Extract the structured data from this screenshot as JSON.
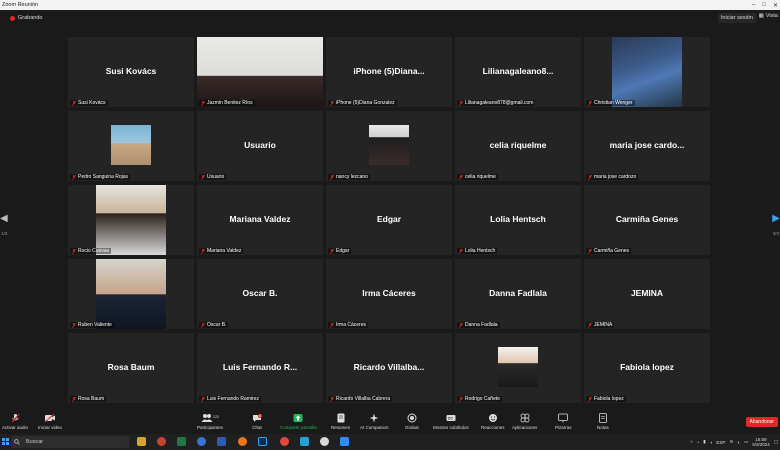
{
  "window": {
    "title": "Zoom Reunión"
  },
  "topbar": {
    "recording_label": "Grabando",
    "signin_label": "Iniciar sesión",
    "view_label": "Vista"
  },
  "pager": {
    "left_label": "1/3",
    "right_label": "3/3"
  },
  "colors": {
    "active_speaker": "#c9e44a",
    "leave_button": "#e02828",
    "tile_bg": "#242424",
    "share_screen": "#1db954"
  },
  "participants": [
    {
      "display": "Susi Kovács",
      "label": "Susi Kovács",
      "video": false
    },
    {
      "display": "",
      "label": "Jazmin Benitez Ríos",
      "video": true,
      "active": true
    },
    {
      "display": "iPhone (5)Diana...",
      "label": "iPhone (5)Diana Gonzalez",
      "video": false
    },
    {
      "display": "Lilianagaleano8...",
      "label": "Lilianagaleano878@gmail.com",
      "video": false
    },
    {
      "display": "",
      "label": "Christian Wenger",
      "video": true
    },
    {
      "display": "",
      "label": "Pedro Sanguina Rojas",
      "video": true
    },
    {
      "display": "Usuario",
      "label": "Usuario",
      "video": false
    },
    {
      "display": "",
      "label": "nancy lezcano",
      "video": true
    },
    {
      "display": "celia riquelme",
      "label": "celia riquelme",
      "video": false
    },
    {
      "display": "maria jose cardo...",
      "label": "maria jose cardozo",
      "video": false
    },
    {
      "display": "",
      "label": "Rocio Cuevas",
      "video": true
    },
    {
      "display": "Mariana Valdez",
      "label": "Mariana Valdez",
      "video": false
    },
    {
      "display": "Edgar",
      "label": "Edgar",
      "video": false
    },
    {
      "display": "Lolia Hentsch",
      "label": "Lolia Hentsch",
      "video": false
    },
    {
      "display": "Carmiña Genes",
      "label": "Carmiña Genes",
      "video": false
    },
    {
      "display": "",
      "label": "Ruben Valiente",
      "video": true
    },
    {
      "display": "Oscar B.",
      "label": "Oscar B.",
      "video": false
    },
    {
      "display": "Irma  Cáceres",
      "label": "Irma  Cáceres",
      "video": false
    },
    {
      "display": "Danna Fadlala",
      "label": "Danna Fadlala",
      "video": false
    },
    {
      "display": "JEMINA",
      "label": "JEMINA",
      "video": false
    },
    {
      "display": "Rosa Baum",
      "label": "Rosa Baum",
      "video": false
    },
    {
      "display": "Luis Fernando R...",
      "label": "Luis Fernando Ramirez",
      "video": false
    },
    {
      "display": "Ricardo  Villalba...",
      "label": "Ricardo Villalba Cabrera",
      "video": false
    },
    {
      "display": "",
      "label": "Rodrigo Cañete",
      "video": true
    },
    {
      "display": "Fabiola lopez",
      "label": "Fabiola lopez",
      "video": false
    }
  ],
  "toolbar": {
    "audio": "Activar audio",
    "video": "Iniciar video",
    "participants": "Participantes",
    "participants_count": "123",
    "chat": "Chat",
    "chat_badge": "5",
    "share": "Compartir pantalla",
    "summary": "Resumen",
    "companion": "AI Companion",
    "record": "Grabar",
    "captions": "Mostrar subtítulos",
    "reactions": "Reacciones",
    "apps": "Aplicaciones",
    "whiteboards": "Pizarras",
    "notes": "Notas",
    "leave": "Abandonar"
  },
  "taskbar": {
    "search_placeholder": "Buscar",
    "language": "ESP",
    "time": "16:59",
    "date": "6/3/2024"
  }
}
